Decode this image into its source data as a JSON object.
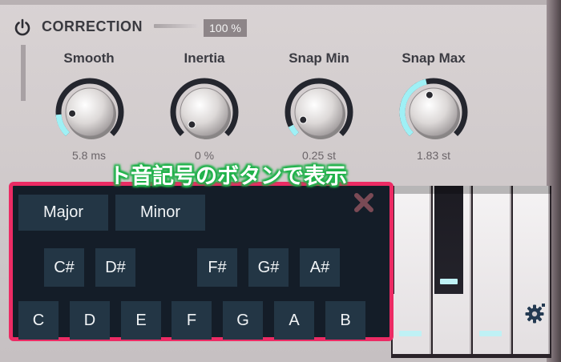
{
  "header": {
    "title": "CORRECTION",
    "percent": "100 %",
    "icon": "power-icon"
  },
  "knobs": [
    {
      "label": "Smooth",
      "value": "5.8 ms",
      "level": 0.15
    },
    {
      "label": "Inertia",
      "value": "0 %",
      "level": 0.0
    },
    {
      "label": "Snap Min",
      "value": "0.25 st",
      "level": 0.07
    },
    {
      "label": "Snap Max",
      "value": "1.83 st",
      "level": 0.45
    }
  ],
  "annotation": {
    "text": "ト音記号のボタンで表示",
    "color": "#1fb24a"
  },
  "popup": {
    "border_color": "#ec2b64",
    "close_icon": "close-x-icon",
    "scales": [
      "Major",
      "Minor"
    ],
    "sharps": [
      "C#",
      "D#",
      "F#",
      "G#",
      "A#"
    ],
    "naturals": [
      "C",
      "D",
      "E",
      "F",
      "G",
      "A",
      "B"
    ]
  },
  "settings": {
    "icon": "gear-icon"
  },
  "colors": {
    "accent": "#9ff0f5",
    "arc": "#24262e",
    "button_bg": "#233645",
    "popup_bg": "#141d28"
  }
}
